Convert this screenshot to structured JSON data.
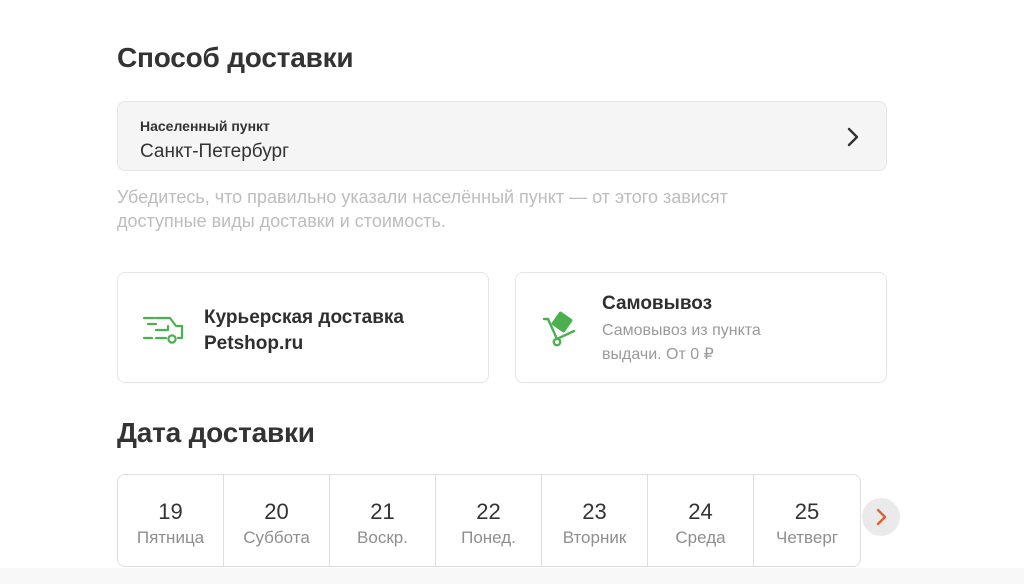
{
  "delivery": {
    "title": "Способ доставки",
    "locality": {
      "label": "Населенный пункт",
      "value": "Санкт-Петербург"
    },
    "hint": "Убедитесь, что правильно указали населённый пункт — от этого зависят доступные виды доставки и стоимость.",
    "options": [
      {
        "icon": "courier-truck-icon",
        "title": "Курьерская доставка Petshop.ru"
      },
      {
        "icon": "pickup-cart-icon",
        "title": "Самовывоз",
        "description": "Самовывоз из пункта выдачи. От 0 ₽"
      }
    ]
  },
  "date_section": {
    "title": "Дата доставки",
    "dates": [
      {
        "num": "19",
        "day": "Пятница"
      },
      {
        "num": "20",
        "day": "Суббота"
      },
      {
        "num": "21",
        "day": "Воскр."
      },
      {
        "num": "22",
        "day": "Понед."
      },
      {
        "num": "23",
        "day": "Вторник"
      },
      {
        "num": "24",
        "day": "Среда"
      },
      {
        "num": "25",
        "day": "Четверг"
      }
    ]
  },
  "colors": {
    "accent_green": "#4caf50",
    "next_arrow": "#e0622b"
  }
}
